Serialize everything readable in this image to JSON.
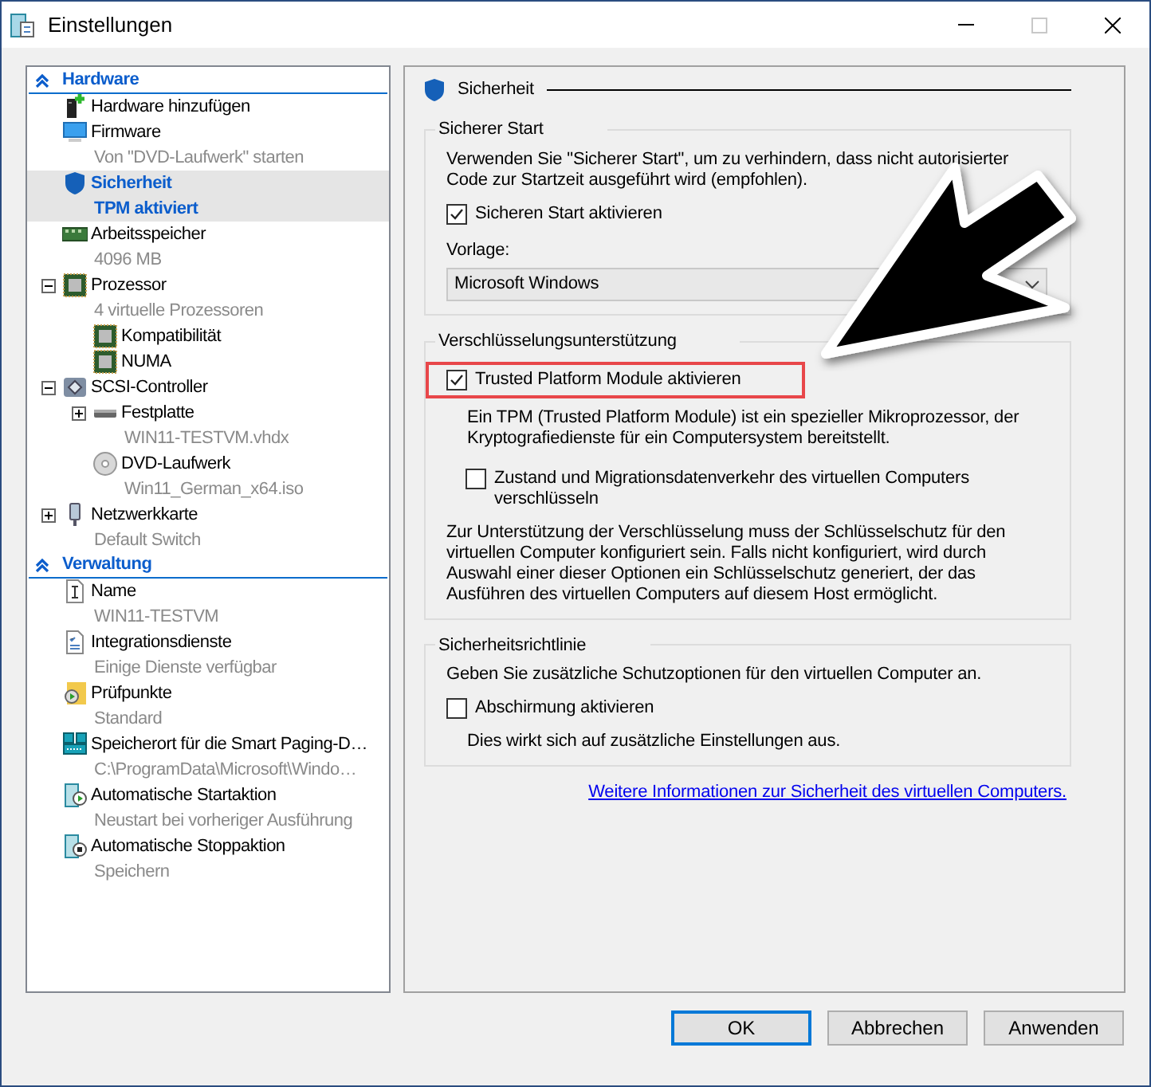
{
  "window": {
    "title": "Einstellungen"
  },
  "tree": {
    "sections": [
      {
        "title": "Hardware",
        "items": [
          {
            "name": "Hardware hinzufügen",
            "selected": false
          },
          {
            "name": "Firmware",
            "subtitle": "Von \"DVD-Laufwerk\" starten",
            "selected": false
          },
          {
            "name": "Sicherheit",
            "subtitle": "TPM aktiviert",
            "selected": true
          },
          {
            "name": "Arbeitsspeicher",
            "subtitle": "4096 MB",
            "selected": false
          },
          {
            "name": "Prozessor",
            "subtitle": "4 virtuelle Prozessoren",
            "selected": false,
            "expanded": true,
            "children": [
              {
                "name": "Kompatibilität",
                "selected": false
              },
              {
                "name": "NUMA",
                "selected": false
              }
            ]
          },
          {
            "name": "SCSI-Controller",
            "selected": false,
            "expanded": true,
            "children": [
              {
                "name": "Festplatte",
                "subtitle": "WIN11-TESTVM.vhdx",
                "selected": false,
                "expanded": false
              },
              {
                "name": "DVD-Laufwerk",
                "subtitle": "Win11_German_x64.iso",
                "selected": false
              }
            ]
          },
          {
            "name": "Netzwerkkarte",
            "subtitle": "Default Switch",
            "selected": false,
            "expanded": false
          }
        ]
      },
      {
        "title": "Verwaltung",
        "items": [
          {
            "name": "Name",
            "subtitle": "WIN11-TESTVM",
            "selected": false
          },
          {
            "name": "Integrationsdienste",
            "subtitle": "Einige Dienste verfügbar",
            "selected": false
          },
          {
            "name": "Prüfpunkte",
            "subtitle": "Standard",
            "selected": false
          },
          {
            "name": "Speicherort für die Smart Paging-D…",
            "subtitle": "C:\\ProgramData\\Microsoft\\Windo…",
            "selected": false
          },
          {
            "name": "Automatische Startaktion",
            "subtitle": "Neustart bei vorheriger Ausführung",
            "selected": false
          },
          {
            "name": "Automatische Stoppaktion",
            "subtitle": "Speichern",
            "selected": false
          }
        ]
      }
    ]
  },
  "panel": {
    "title": "Sicherheit",
    "groups": [
      {
        "title": "Sicherer Start",
        "items": [
          {
            "kind": "text",
            "text": "Verwenden Sie \"Sicherer Start\", um zu verhindern, dass nicht autorisierter Code zur Startzeit ausgeführt wird (empfohlen)."
          },
          {
            "kind": "checkbox",
            "label": "Sicheren Start aktivieren",
            "checked": true,
            "highlighted": false
          },
          {
            "kind": "select",
            "label": "Vorlage:",
            "value": "Microsoft Windows"
          }
        ]
      },
      {
        "title": "Verschlüsselungsunterstützung",
        "items": [
          {
            "kind": "checkbox",
            "label": "Trusted Platform Module aktivieren",
            "checked": true,
            "highlighted": true
          },
          {
            "kind": "note",
            "text": "Ein TPM (Trusted Platform Module) ist ein spezieller Mikroprozessor, der Kryptografiedienste für ein Computersystem bereitstellt."
          },
          {
            "kind": "suboption",
            "label": "Zustand und Migrationsdatenverkehr des virtuellen Computers verschlüsseln",
            "checked": false,
            "highlighted": false
          },
          {
            "kind": "text",
            "text": "Zur Unterstützung der Verschlüsselung muss der Schlüsselschutz für den virtuellen Computer konfiguriert sein. Falls nicht konfiguriert, wird durch Auswahl einer dieser Optionen ein Schlüsselschutz generiert, der das Ausführen des virtuellen Computers auf diesem Host ermöglicht."
          }
        ]
      },
      {
        "title": "Sicherheitsrichtlinie",
        "items": [
          {
            "kind": "text",
            "text": "Geben Sie zusätzliche Schutzoptionen für den virtuellen Computer an."
          },
          {
            "kind": "checkbox",
            "label": "Abschirmung aktivieren",
            "checked": false,
            "highlighted": false
          },
          {
            "kind": "note",
            "text": "Dies wirkt sich auf zusätzliche Einstellungen aus."
          }
        ]
      }
    ],
    "link": "Weitere Informationen zur Sicherheit des virtuellen Computers."
  },
  "buttons": [
    {
      "label": "OK",
      "default": true
    },
    {
      "label": "Abbrechen",
      "default": false
    },
    {
      "label": "Anwenden",
      "default": false
    }
  ]
}
